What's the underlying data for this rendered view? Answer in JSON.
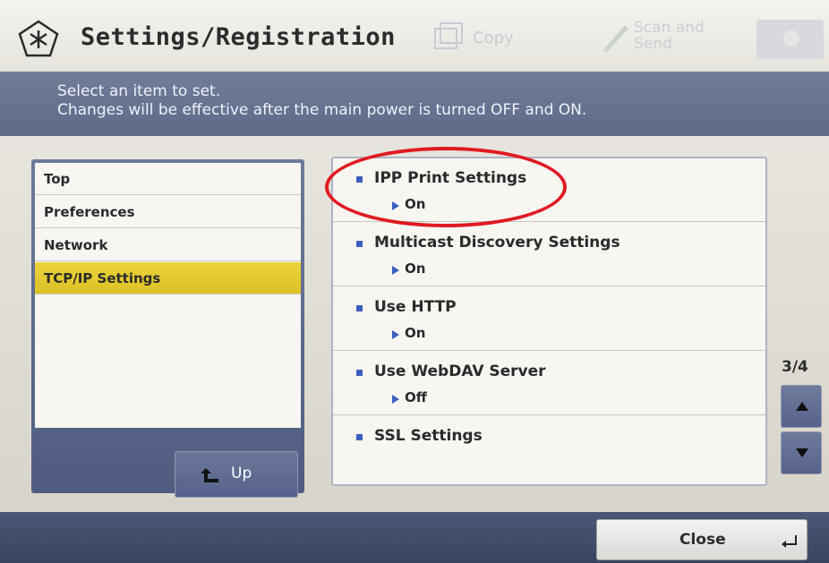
{
  "header": {
    "title": "Settings/Registration",
    "icons": {
      "title": "settings-icon",
      "copy": "copy-icon",
      "scan": "scan-icon",
      "status": "status-icon"
    },
    "copy_label": "Copy",
    "scan_label_line1": "Scan and",
    "scan_label_line2": "Send"
  },
  "message": {
    "line1": "Select an item to set.",
    "line2": "Changes will be effective after the main power is turned OFF and ON."
  },
  "sidebar": {
    "items": [
      {
        "label": "Top",
        "selected": false
      },
      {
        "label": "Preferences",
        "selected": false
      },
      {
        "label": "Network",
        "selected": false
      },
      {
        "label": "TCP/IP Settings",
        "selected": true
      }
    ],
    "up_label": "Up"
  },
  "settings": {
    "items": [
      {
        "title": "IPP Print Settings",
        "value": "On"
      },
      {
        "title": "Multicast Discovery Settings",
        "value": "On"
      },
      {
        "title": "Use HTTP",
        "value": "On"
      },
      {
        "title": "Use WebDAV Server",
        "value": "Off"
      },
      {
        "title": "SSL Settings",
        "value": ""
      }
    ],
    "page_indicator": "3/4"
  },
  "footer": {
    "close_label": "Close"
  },
  "colors": {
    "accent_selected": "#e4c92c",
    "annotation": "#e01a22",
    "bar_blue": "#5e6a88"
  }
}
